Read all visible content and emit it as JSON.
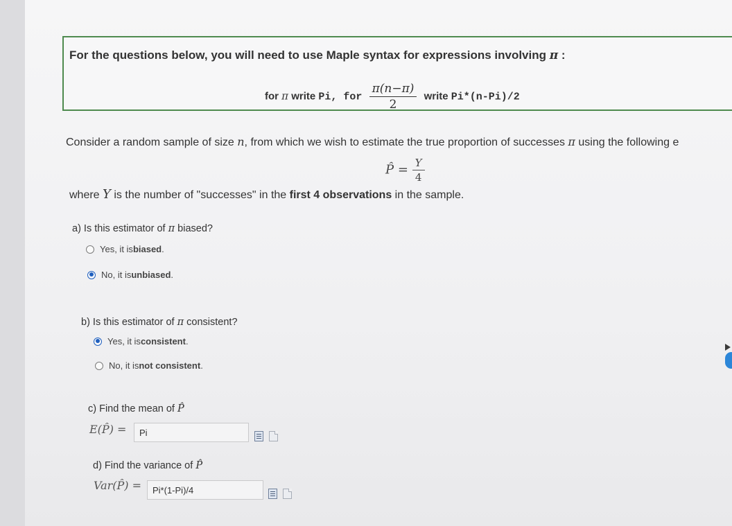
{
  "notice": {
    "title": "For the questions below, you will need to use Maple syntax for expressions involving ",
    "title_symbol": "π",
    "title_end": " :",
    "for_word": "for ",
    "pi_symbol": "π",
    "write_word": " write ",
    "pi_code": "Pi",
    "sep": ", for",
    "frac_num": "π(n−π)",
    "frac_den": "2",
    "write_word2": " write ",
    "expr_code": "Pi*(n-Pi)/2"
  },
  "intro": {
    "text1": "Consider a random sample of size ",
    "n": "n",
    "text2": ", from which we wish to estimate the true proportion of successes ",
    "pi": "π",
    "text3": " using the following e"
  },
  "estimator": {
    "lhs": "P̂",
    "eq": " = ",
    "num": "Y",
    "den": "4"
  },
  "where": {
    "text1": "where ",
    "Y": "Y",
    "text2": " is the number of \"successes\" in the ",
    "bold": "first 4 observations",
    "text3": " in the sample."
  },
  "qa": {
    "label": "a) Is this estimator of ",
    "pi": "π",
    "label_end": " biased?",
    "options": [
      {
        "pre": "Yes, it is ",
        "bold": "biased",
        "post": ".",
        "selected": false
      },
      {
        "pre": "No, it is ",
        "bold": "unbiased",
        "post": ".",
        "selected": true
      }
    ]
  },
  "qb": {
    "label": "b) Is this estimator of ",
    "pi": "π",
    "label_end": " consistent?",
    "options": [
      {
        "pre": "Yes, it is ",
        "bold": "consistent",
        "post": ".",
        "selected": true
      },
      {
        "pre": "No, it is ",
        "bold": "not consistent",
        "post": ".",
        "selected": false
      }
    ]
  },
  "qc": {
    "label": "c) Find the mean of ",
    "sym": "P̂",
    "lhs": "E(P̂) = ",
    "value": "Pi"
  },
  "qd": {
    "label": "d) Find the variance of ",
    "sym": "P̂",
    "lhs": "Var(P̂) = ",
    "value": "Pi*(1-Pi)/4"
  },
  "icons": [
    "preview-icon",
    "help-icon"
  ],
  "colors": {
    "radio_selected": "#1f5fbf",
    "box_border": "#4e8a4e",
    "scroll_thumb": "#2c86d8"
  }
}
